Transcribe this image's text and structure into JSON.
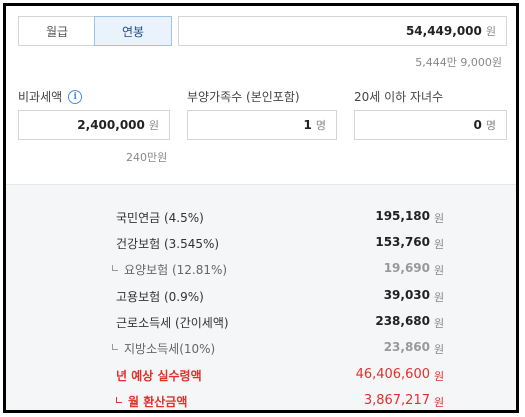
{
  "tabs": [
    {
      "label": "월급",
      "active": false
    },
    {
      "label": "연봉",
      "active": true
    }
  ],
  "salary": {
    "value": "54,449,000",
    "unit": "원",
    "hint": "5,444만 9,000원"
  },
  "fields": {
    "non_taxable": {
      "label": "비과세액",
      "value": "2,400,000",
      "unit": "원",
      "hint": "240만원",
      "icon": "info-icon"
    },
    "dependents": {
      "label": "부양가족수 (본인포함)",
      "value": "1",
      "unit": "명"
    },
    "children": {
      "label": "20세 이하 자녀수",
      "value": "0",
      "unit": "명"
    }
  },
  "results": [
    {
      "name": "국민연금 (4.5%)",
      "value": "195,180",
      "unit": "원"
    },
    {
      "name": "건강보험 (3.545%)",
      "value": "153,760",
      "unit": "원"
    },
    {
      "name": "요양보험 (12.81%)",
      "value": "19,690",
      "unit": "원"
    },
    {
      "name": "고용보험 (0.9%)",
      "value": "39,030",
      "unit": "원"
    },
    {
      "name": "근로소득세 (간이세액)",
      "value": "238,680",
      "unit": "원"
    },
    {
      "name": "지방소득세(10%)",
      "value": "23,860",
      "unit": "원"
    },
    {
      "name": "년 예상 실수령액",
      "value": "46,406,600",
      "unit": "원"
    },
    {
      "name": "월 환산금액",
      "value": "3,867,217",
      "unit": "원"
    }
  ],
  "colors": {
    "accent": "#e0312b",
    "tab_active_bg": "#eaf2fb",
    "results_bg": "#f5f6f8"
  }
}
